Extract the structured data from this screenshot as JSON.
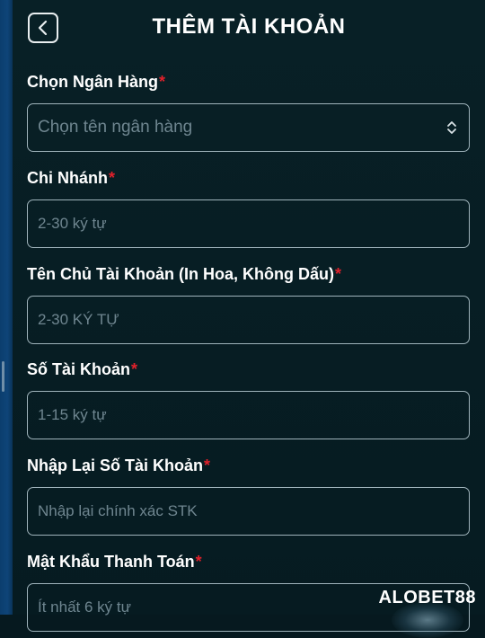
{
  "header": {
    "title": "THÊM TÀI KHOẢN",
    "back_icon": "chevron-left-icon"
  },
  "form": {
    "required_mark": "*",
    "fields": [
      {
        "label": "Chọn Ngân Hàng",
        "placeholder": "Chọn tên ngân hàng",
        "type": "select",
        "icon": "chevron-up-down-icon"
      },
      {
        "label": "Chi Nhánh",
        "placeholder": "2-30 ký tự",
        "type": "text"
      },
      {
        "label": "Tên Chủ Tài Khoản (In Hoa, Không Dấu)",
        "placeholder": "2-30 KÝ TỰ",
        "type": "text"
      },
      {
        "label": "Số Tài Khoản",
        "placeholder": "1-15 ký tự",
        "type": "text"
      },
      {
        "label": "Nhập Lại Số Tài Khoản",
        "placeholder": "Nhập lại chính xác STK",
        "type": "text"
      },
      {
        "label": "Mật Khẩu Thanh Toán",
        "placeholder": "Ít nhất 6 ký tự",
        "type": "password"
      }
    ]
  },
  "watermark": {
    "text": "ALOBET88"
  },
  "colors": {
    "background": "#06191f",
    "required": "#e0212b",
    "border": "#9fb3bb",
    "placeholder": "#6f8690",
    "left_edge": "#0e4478"
  }
}
